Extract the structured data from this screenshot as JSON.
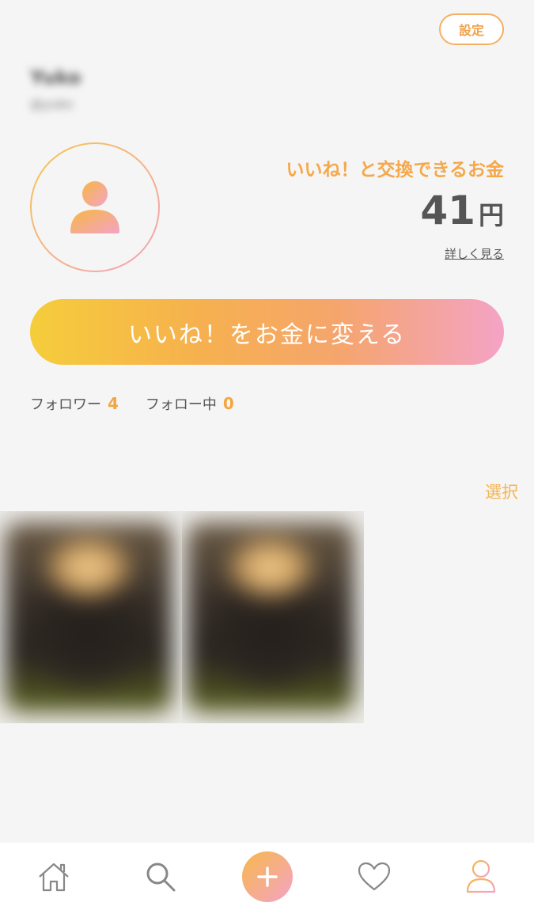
{
  "header": {
    "settings_label": "設定",
    "user_name": "Yuko",
    "user_id": "@yuko"
  },
  "wallet": {
    "title": "いいね！と交換できるお金",
    "amount": "41",
    "unit": "円",
    "detail_link": "詳しく見る",
    "convert_button": "いいね！をお金に変える"
  },
  "stats": {
    "followers_label": "フォロワー",
    "followers_count": "4",
    "following_label": "フォロー中",
    "following_count": "0"
  },
  "posts": {
    "select_label": "選択",
    "items": [
      "photo-1",
      "photo-2"
    ]
  },
  "nav": {
    "items": [
      "home-icon",
      "search-icon",
      "add-icon",
      "heart-icon",
      "profile-icon"
    ],
    "active": "profile-icon"
  },
  "colors": {
    "accent_orange": "#f5a84a",
    "accent_yellow": "#f5cd3a",
    "accent_pink": "#f4a3c6",
    "text_gray": "#555555",
    "background": "#f5f5f5"
  }
}
